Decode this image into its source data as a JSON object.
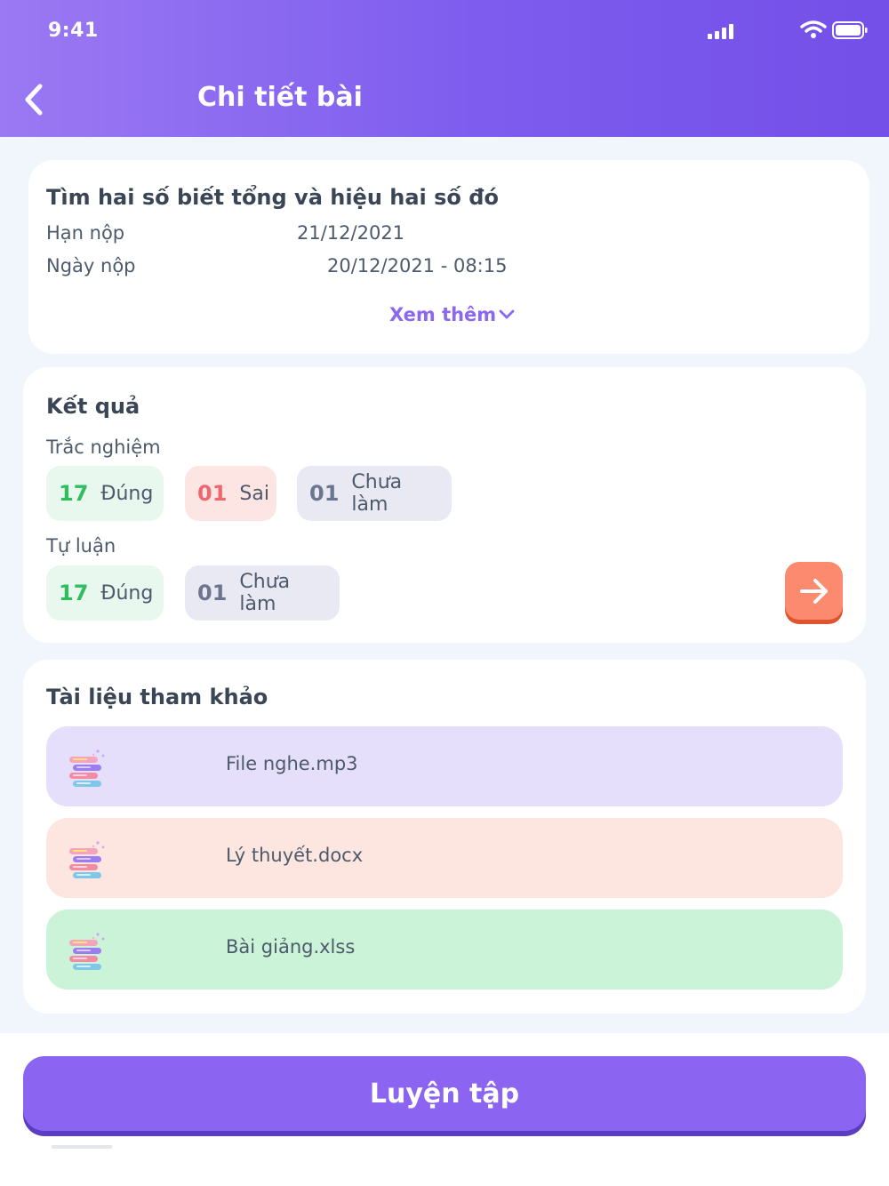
{
  "status_bar": {
    "time": "9:41"
  },
  "header": {
    "title": "Chi tiết bài"
  },
  "lesson": {
    "title": "Tìm hai số biết tổng và hiệu hai số đó",
    "deadline_label": "Hạn nộp",
    "deadline_value": "21/12/2021",
    "submitted_label": "Ngày nộp",
    "submitted_value": "20/12/2021 - 08:15",
    "see_more": "Xem thêm"
  },
  "result": {
    "title": "Kết quả",
    "multiple_choice": {
      "label": "Trắc nghiệm",
      "correct_num": "17",
      "correct_label": "Đúng",
      "wrong_num": "01",
      "wrong_label": "Sai",
      "undone_num": "01",
      "undone_label": "Chưa làm"
    },
    "essay": {
      "label": "Tự luận",
      "correct_num": "17",
      "correct_label": "Đúng",
      "undone_num": "01",
      "undone_label": "Chưa làm"
    }
  },
  "references": {
    "title": "Tài liệu tham khảo",
    "items": [
      {
        "name": "File nghe.mp3",
        "color": "#e5dffb"
      },
      {
        "name": "Lý thuyết.docx",
        "color": "#fde6e0"
      },
      {
        "name": "Bài giảng.xlss",
        "color": "#cbf3d8"
      }
    ]
  },
  "footer": {
    "practice_label": "Luyện tập"
  },
  "colors": {
    "header_gradient": [
      "#9b79f3",
      "#744fe8"
    ],
    "accent": "#8b65f1",
    "correct": "#2fbd5e",
    "wrong": "#f0666e",
    "arrow_button": "#fb8a6e"
  }
}
